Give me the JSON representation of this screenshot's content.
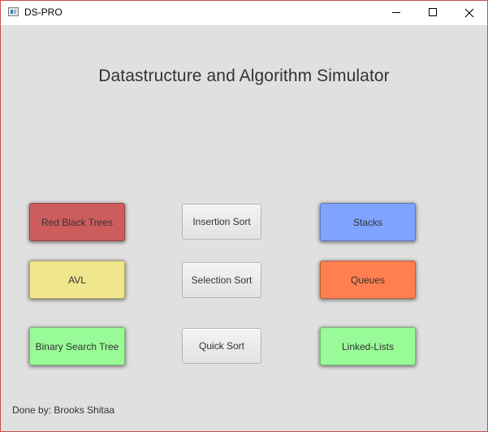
{
  "window": {
    "title": "DS-PRO"
  },
  "heading": "Datastructure and Algorithm Simulator",
  "buttons": {
    "red_black_trees": "Red Black Trees",
    "avl": "AVL",
    "binary_search_tree": "Binary Search Tree",
    "insertion_sort": "Insertion Sort",
    "selection_sort": "Selection Sort",
    "quick_sort": "Quick Sort",
    "stacks": "Stacks",
    "queues": "Queues",
    "linked_lists": "Linked-Lists"
  },
  "footer": "Done by: Brooks Shitaa",
  "colors": {
    "red_black_trees": "#cd5c5c",
    "avl": "#f0e68c",
    "binary_search_tree": "#98fb98",
    "stacks": "#7fa3ff",
    "queues": "#ff7f50",
    "linked_lists": "#98fb98",
    "window_background": "#e0e0e0"
  }
}
